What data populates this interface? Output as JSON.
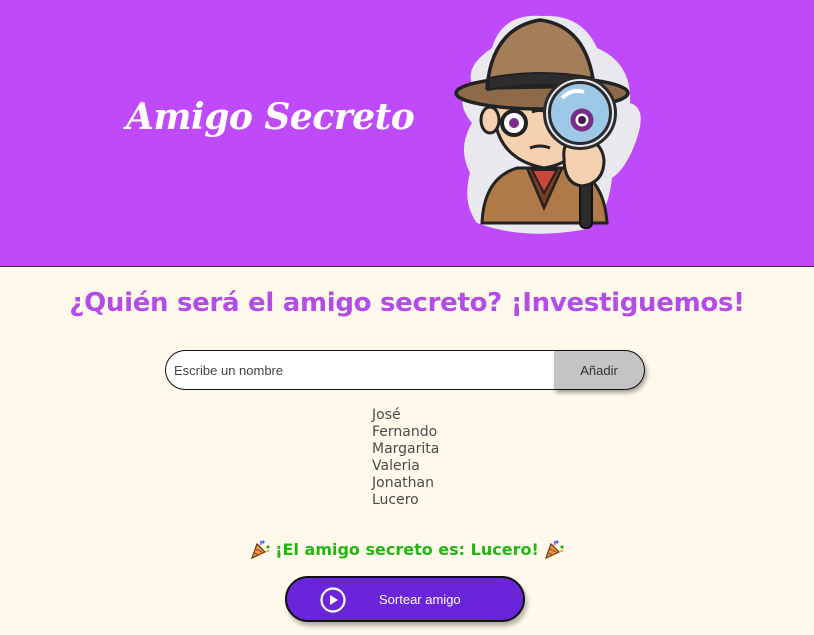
{
  "header": {
    "title": "Amigo Secreto",
    "illustration": "detective-with-magnifying-glass",
    "background_color": "#BE4AF9"
  },
  "main": {
    "heading": "¿Quién será el amigo secreto? ¡Investiguemos!",
    "heading_color": "#B24DE8",
    "input": {
      "placeholder": "Escribe un nombre",
      "value": ""
    },
    "add_button_label": "Añadir",
    "names": [
      "José",
      "Fernando",
      "Margarita",
      "Valeria",
      "Jonathan",
      "Lucero"
    ],
    "result": {
      "text": "¡El amigo secreto es: Lucero!",
      "icon": "party-popper-icon",
      "color": "#22B513"
    },
    "draw_button": {
      "label": "Sortear amigo",
      "icon": "play-circle-icon",
      "color": "#6A25DA"
    }
  }
}
